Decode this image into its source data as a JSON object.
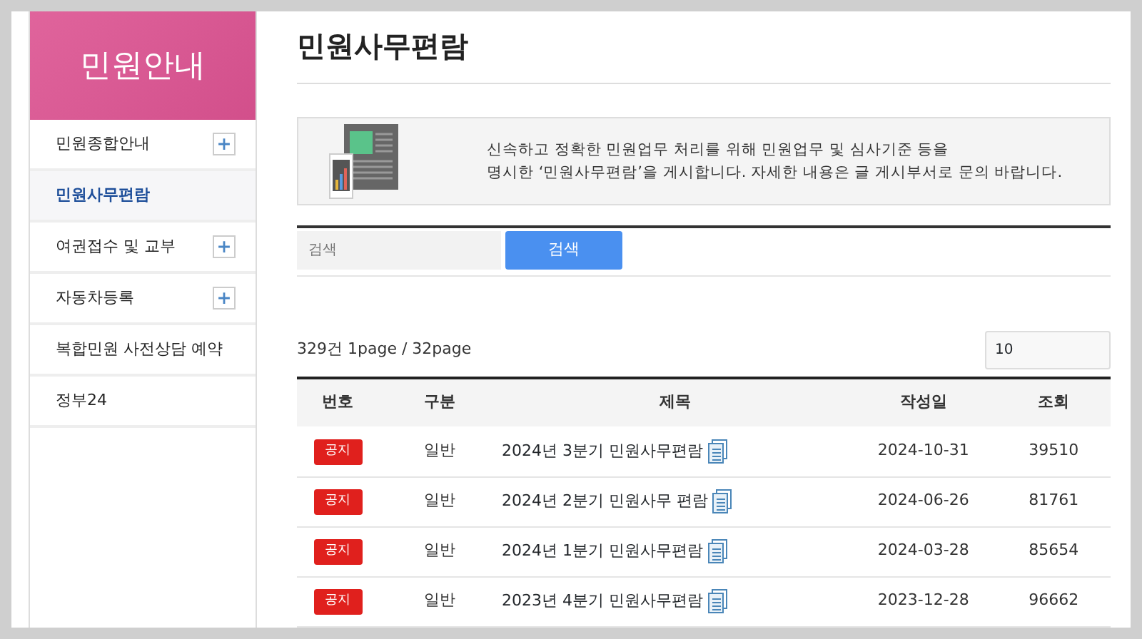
{
  "sidebar": {
    "title": "민원안내",
    "items": [
      {
        "label": "민원종합안내",
        "selected": false,
        "has_submenu": true
      },
      {
        "label": "민원사무편람",
        "selected": true,
        "has_submenu": false
      },
      {
        "label": "여권접수 및 교부",
        "selected": false,
        "has_submenu": true
      },
      {
        "label": "자동차등록",
        "selected": false,
        "has_submenu": true
      },
      {
        "label": "복합민원 사전상담 예약",
        "selected": false,
        "has_submenu": false
      },
      {
        "label": "정부24",
        "selected": false,
        "has_submenu": false
      }
    ]
  },
  "page_title": "민원사무편람",
  "info": {
    "lines": [
      "신속하고 정확한 민원업무 처리를 위해 민원업무 및 심사기준 등을",
      "명시한 ‘민원사무편람’을 게시합니다. 자세한 내용은 글 게시부서로 문의 바랍니다."
    ]
  },
  "search": {
    "placeholder": "검색",
    "button": "검색"
  },
  "summary": "329건 1page / 32page",
  "page_size": "10",
  "table": {
    "columns": [
      "번호",
      "구분",
      "제목",
      "작성일",
      "조회"
    ],
    "rows": [
      {
        "badge": "공지",
        "category": "일반",
        "title": "2024년 3분기 민원사무편람",
        "attachment": true,
        "date": "2024-10-31",
        "views": "39510"
      },
      {
        "badge": "공지",
        "category": "일반",
        "title": "2024년 2분기 민원사무 편람",
        "attachment": true,
        "date": "2024-06-26",
        "views": "81761"
      },
      {
        "badge": "공지",
        "category": "일반",
        "title": "2024년 1분기 민원사무편람",
        "attachment": true,
        "date": "2024-03-28",
        "views": "85654"
      },
      {
        "badge": "공지",
        "category": "일반",
        "title": "2023년 4분기 민원사무편람",
        "attachment": true,
        "date": "2023-12-28",
        "views": "96662"
      }
    ]
  }
}
